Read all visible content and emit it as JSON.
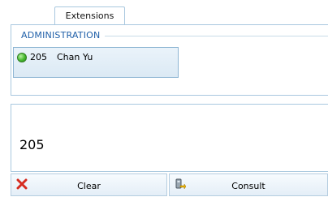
{
  "tabs": [
    {
      "label": "Extensions"
    }
  ],
  "group": {
    "title": "ADMINISTRATION",
    "extensions": [
      {
        "number": "205",
        "name": "Chan Yu",
        "status_color": "#45b82e"
      }
    ]
  },
  "dial_input": {
    "value": "205"
  },
  "buttons": {
    "clear_label": "Clear",
    "consult_label": "Consult"
  },
  "icons": {
    "clear": "red-x-icon",
    "consult": "phone-transfer-icon",
    "status": "green-status-dot-icon"
  }
}
